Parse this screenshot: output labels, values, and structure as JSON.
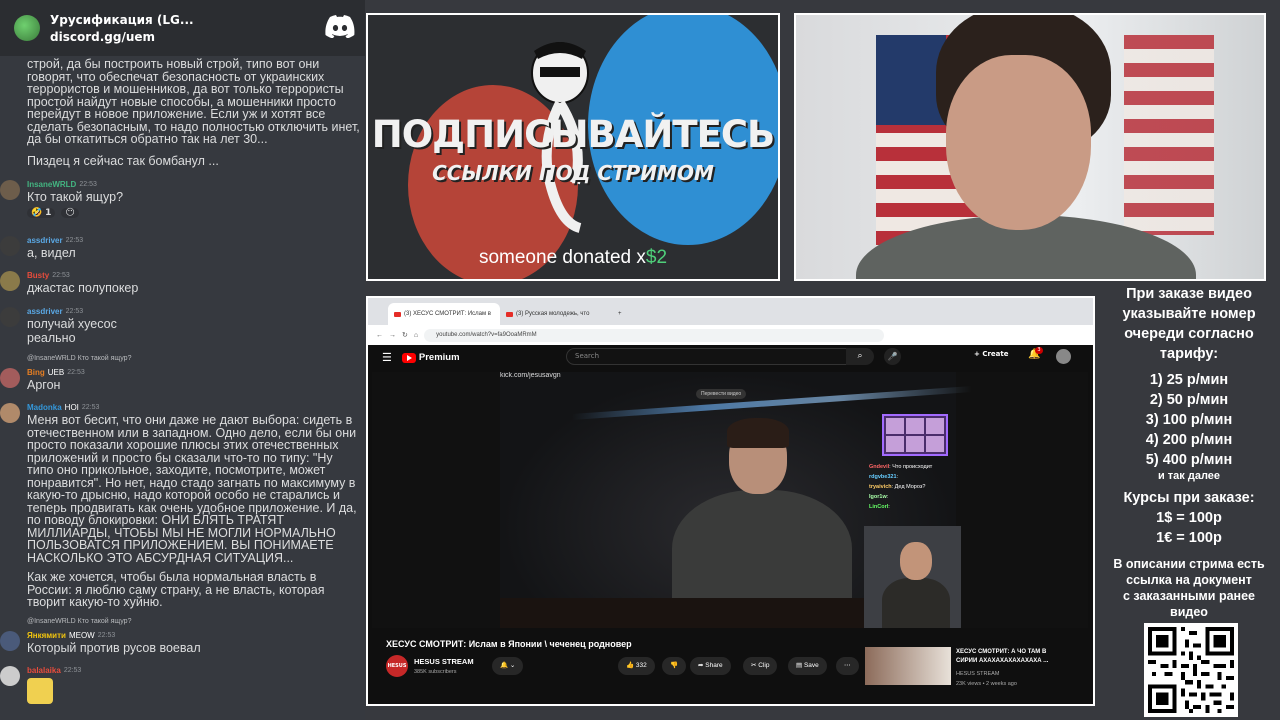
{
  "discord": {
    "server_name": "Урусификация (LG...",
    "invite": "discord.gg/uem"
  },
  "chat": {
    "long_msg_1": "строй, да бы построить новый строй, типо вот они говорят, что обеспечат безопасность от украинских террористов и мошенников, да вот только террористы простой найдут новые способы, а мошенники просто перейдут в новое приложение. Если уж и хотят все сделать безопасным, то надо полностью отключить инет, да бы откатиться обратно так на лет 30...",
    "long_msg_1_tail": "Пиздец я сейчас так бомбанул ...",
    "m1_user": "InsaneWRLD",
    "m1_time": "22:53",
    "m1_text": "Кто такой ящур?",
    "m1_reaction_1": "1",
    "m2_user": "assdriver",
    "m2_time": "22:53",
    "m2_text": "а, видел",
    "m3_user": "Busty",
    "m3_time": "22:53",
    "m3_text": "джастас полупокер",
    "m4_user": "assdriver",
    "m4_time": "22:53",
    "m4_text_1": "получай хуесос",
    "m4_text_2": "реально",
    "m5_reply": "@InsaneWRLD Кто такой ящур?",
    "m5_user": "Bing",
    "m5_badge": "UEB",
    "m5_time": "22:53",
    "m5_text": "Аргон",
    "m6_user": "Madonka",
    "m6_badge": "HOI",
    "m6_time": "22:53",
    "m6_text": "Меня вот бесит, что они даже не дают выбора: сидеть в отечественном или в западном. Одно дело, если бы они просто показали хорошие плюсы этих отечественных приложений и просто бы сказали что-то по типу: \"Ну типо оно прикольное, заходите, посмотрите, может понравится\". Но нет, надо стадо загнать по максимуму в какую-то дрысню, надо которой особо не старались и теперь продвигать как очень удобное приложение. И да, по поводу блокировки: ОНИ БЛЯТЬ ТРАТЯТ МИЛЛИАРДЫ, ЧТОБЫ МЫ НЕ МОГЛИ НОРМАЛЬНО ПОЛЬЗОВАТСЯ ПРИЛОЖЕНИЕМ. ВЫ ПОНИМАЕТЕ НАСКОЛЬКО ЭТО АБСУРДНАЯ СИТУАЦИЯ...",
    "m6_text_2": "Как же хочется, чтобы была нормальная власть в России: я люблю саму страну, а не власть, которая творит какую-то хуйню.",
    "m7_reply": "@InsaneWRLD Кто такой ящур?",
    "m7_user": "Янкямити",
    "m7_badge": "MEOW",
    "m7_time": "22:53",
    "m7_text": "Который против русов воевал",
    "m8_user": "balalaika",
    "m8_time": "22:53"
  },
  "promo": {
    "main": "ПОДПИСЫВАЙТЕСЬ",
    "sub": "ССЫЛКИ ПОД СТРИМОМ",
    "donate_prefix": "someone donated x",
    "donate_amount": "$2"
  },
  "browser": {
    "tab1": "(3) ХЕСУС СМОТРИТ: Ислам в",
    "tab2": "(3) Русская молодежь, что",
    "url": "youtube.com/watch?v=fa9OoaMRmM",
    "yt_brand": "Premium",
    "search_placeholder": "Search",
    "create": "Create",
    "notif_count": "3",
    "kick_url": "kick.com/jesusavgn",
    "translate": "Перевести видео",
    "overlay_chat": [
      {
        "n": "Gndevil",
        "t": ": Что происходит"
      },
      {
        "n": "rdgvbe321",
        "t": ":"
      },
      {
        "n": "tryaivich",
        "t": ": Дед Мороз?"
      },
      {
        "n": "Igor1w",
        "t": ":"
      },
      {
        "n": "LinCorl",
        "t": ":"
      }
    ],
    "video_title": "ХЕСУС СМОТРИТ: Ислам в Японии \\ чеченец родновер",
    "channel_avatar": "HESUS",
    "channel": "HESUS STREAM",
    "subs": "385K subscribers",
    "likes": "332",
    "share": "Share",
    "clip": "Clip",
    "save": "Save",
    "rec_title": "ХЕСУС СМОТРИТ: А ЧО ТАМ В СИРИИ АХАХАХАХАХАХАХА ...",
    "rec_channel": "HESUS STREAM",
    "rec_views": "23K views • 2 weeks ago"
  },
  "info": {
    "line1": "При заказе видео",
    "line2": "указывайте номер",
    "line3": "очереди согласно",
    "line4": "тарифу:",
    "tariffs": [
      "1) 25 р/мин",
      "2) 50 р/мин",
      "3) 100 р/мин",
      "4) 200 р/мин",
      "5) 400 р/мин"
    ],
    "and_more": "и так далее",
    "courses_title": "Курсы при заказе:",
    "rate_usd": "1$ = 100р",
    "rate_eur": "1€ = 100р",
    "desc1": "В описании стрима есть",
    "desc2": "ссылка на документ",
    "desc3": "с заказанными ранее",
    "desc4": "видео"
  }
}
